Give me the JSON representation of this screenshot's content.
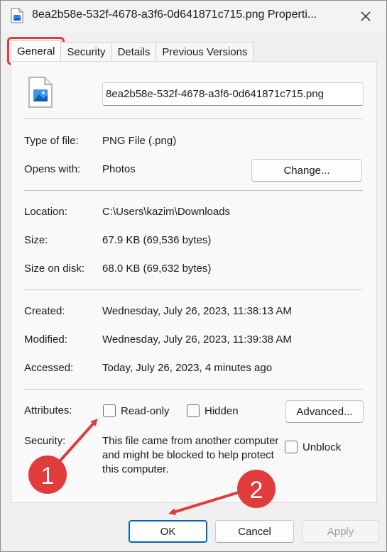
{
  "window": {
    "title": "8ea2b58e-532f-4678-a3f6-0d641871c715.png Properti...",
    "close_glyph": "✕"
  },
  "tabs": [
    {
      "label": "General",
      "active": true
    },
    {
      "label": "Security",
      "active": false
    },
    {
      "label": "Details",
      "active": false
    },
    {
      "label": "Previous Versions",
      "active": false
    }
  ],
  "file": {
    "name_value": "8ea2b58e-532f-4678-a3f6-0d641871c715.png",
    "icon": "png-image-file-icon"
  },
  "type_section": {
    "type_label": "Type of file:",
    "type_value": "PNG File (.png)",
    "opens_label": "Opens with:",
    "opens_value": "Photos",
    "change_button": "Change..."
  },
  "location_section": {
    "location_label": "Location:",
    "location_value": "C:\\Users\\kazim\\Downloads",
    "size_label": "Size:",
    "size_value": "67.9 KB (69,536 bytes)",
    "disk_label": "Size on disk:",
    "disk_value": "68.0 KB (69,632 bytes)"
  },
  "dates_section": {
    "created_label": "Created:",
    "created_value": "Wednesday, July 26, 2023, 11:38:13 AM",
    "modified_label": "Modified:",
    "modified_value": "Wednesday, July 26, 2023, 11:39:38 AM",
    "accessed_label": "Accessed:",
    "accessed_value": "Today, July 26, 2023, 4 minutes ago"
  },
  "attributes": {
    "label": "Attributes:",
    "readonly_label": "Read-only",
    "readonly_checked": false,
    "hidden_label": "Hidden",
    "hidden_checked": false,
    "advanced_button": "Advanced..."
  },
  "security": {
    "label": "Security:",
    "text": "This file came from another computer and might be blocked to help protect this computer.",
    "unblock_label": "Unblock",
    "unblock_checked": false
  },
  "footer": {
    "ok_button": "OK",
    "cancel_button": "Cancel",
    "apply_button": "Apply"
  },
  "annotations": {
    "marker_1": "1",
    "marker_2": "2",
    "color": "#e03c3c"
  },
  "colors": {
    "accent": "#0067c0",
    "annotation_red": "#e03c3c"
  }
}
